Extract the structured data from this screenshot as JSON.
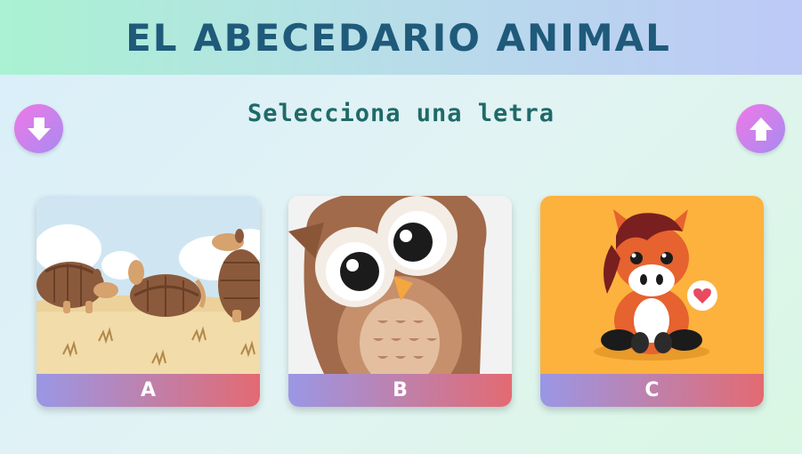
{
  "header": {
    "title": "EL ABECEDARIO ANIMAL"
  },
  "subtitle": "Selecciona una letra",
  "nav": {
    "prev_icon": "arrow-down-icon",
    "next_icon": "arrow-up-icon"
  },
  "cards": [
    {
      "letter": "A",
      "animal_icon": "armadillo-illustration",
      "bg": "#cfe6f2"
    },
    {
      "letter": "B",
      "animal_icon": "owl-illustration",
      "bg": "#f2f2f2"
    },
    {
      "letter": "C",
      "animal_icon": "horse-illustration",
      "bg": "#fcb23d"
    }
  ],
  "colors": {
    "title": "#1f5a7a",
    "subtitle": "#1f6a68",
    "label_gradient_start": "#9a97e6",
    "label_gradient_end": "#e36a72",
    "nav_gradient_start": "#f078e8",
    "nav_gradient_end": "#a78bf0"
  }
}
